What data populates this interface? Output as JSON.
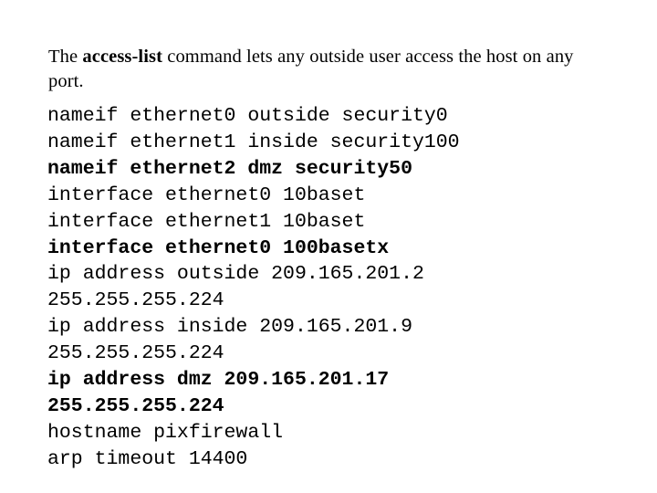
{
  "intro": {
    "before": "The ",
    "command": "access-list",
    "after": " command lets any outside user access the host on any port."
  },
  "config": {
    "lines": [
      {
        "text": "nameif ethernet0 outside security0",
        "bold": false
      },
      {
        "text": "nameif ethernet1 inside security100",
        "bold": false
      },
      {
        "text": "nameif ethernet2 dmz security50",
        "bold": true
      },
      {
        "text": "interface ethernet0 10baset",
        "bold": false
      },
      {
        "text": "interface ethernet1 10baset",
        "bold": false
      },
      {
        "text": "interface ethernet0 100basetx",
        "bold": true
      },
      {
        "text": "ip address outside 209.165.201.2",
        "bold": false
      },
      {
        "text": "255.255.255.224",
        "bold": false
      },
      {
        "text": "ip address inside 209.165.201.9",
        "bold": false
      },
      {
        "text": "255.255.255.224",
        "bold": false
      },
      {
        "text": "ip address dmz 209.165.201.17",
        "bold": true
      },
      {
        "text": "255.255.255.224",
        "bold": true
      },
      {
        "text": "hostname pixfirewall",
        "bold": false
      },
      {
        "text": "arp timeout 14400",
        "bold": false
      }
    ]
  }
}
